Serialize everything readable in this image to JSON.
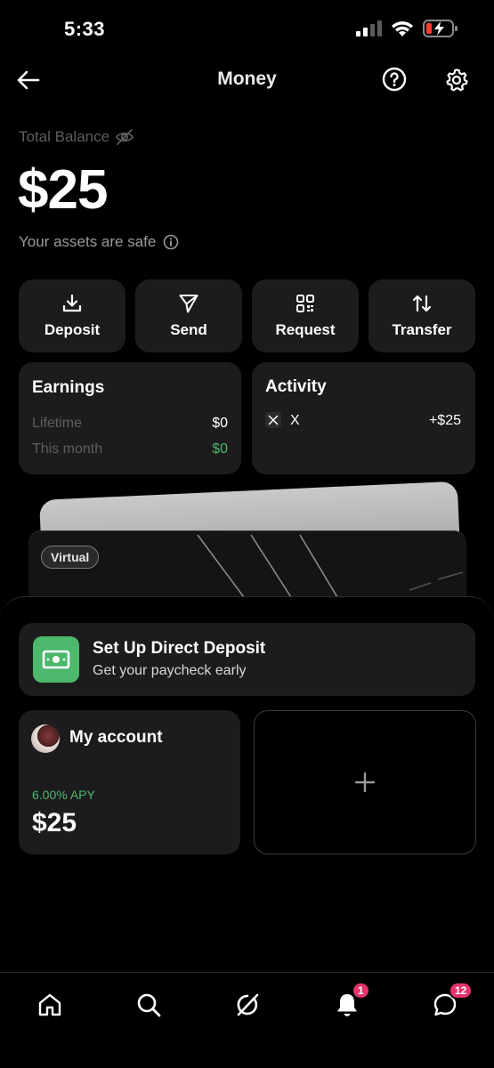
{
  "status_bar": {
    "time": "5:33"
  },
  "header": {
    "title": "Money"
  },
  "balance": {
    "label": "Total Balance",
    "amount": "$25",
    "safe_text": "Your assets are safe"
  },
  "actions": [
    {
      "label": "Deposit",
      "icon": "download-icon"
    },
    {
      "label": "Send",
      "icon": "send-icon"
    },
    {
      "label": "Request",
      "icon": "qr-code-icon"
    },
    {
      "label": "Transfer",
      "icon": "transfer-arrows-icon"
    }
  ],
  "earnings": {
    "title": "Earnings",
    "rows": [
      {
        "label": "Lifetime",
        "value": "$0"
      },
      {
        "label": "This month",
        "value": "$0"
      }
    ]
  },
  "activity": {
    "title": "Activity",
    "items": [
      {
        "name": "X",
        "amount": "+$25"
      }
    ]
  },
  "card": {
    "badge": "Virtual"
  },
  "direct_deposit": {
    "title": "Set Up Direct Deposit",
    "subtitle": "Get your paycheck early"
  },
  "account": {
    "title": "My account",
    "apy": "6.00% APY",
    "balance": "$25"
  },
  "tab_bar": {
    "notifications_badge": "1",
    "messages_badge": "12"
  },
  "colors": {
    "background": "#000000",
    "surface": "#1c1c1e",
    "positive": "#4cb86b",
    "badge": "#e8336d"
  }
}
